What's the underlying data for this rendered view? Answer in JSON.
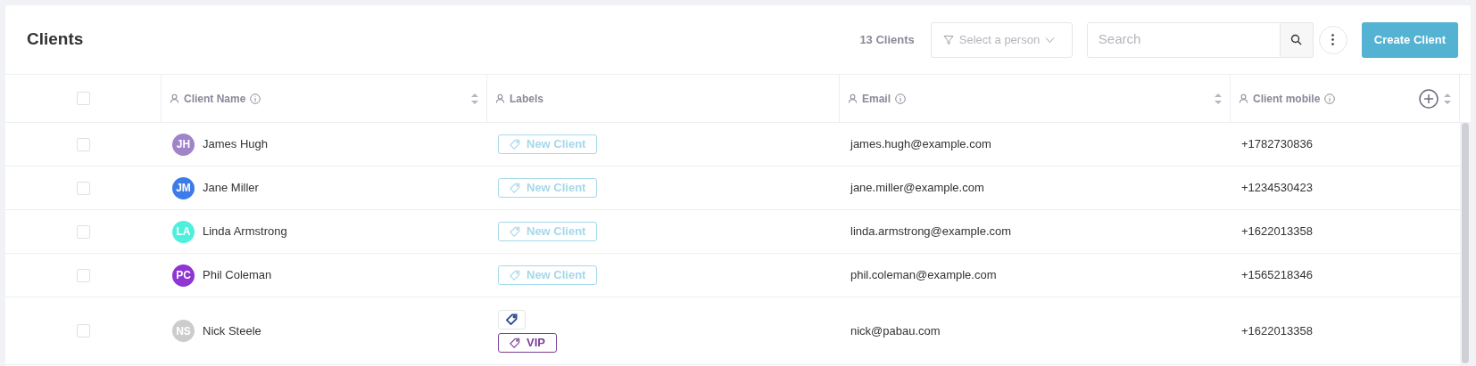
{
  "header": {
    "title": "Clients",
    "count": "13 Clients",
    "person_filter": {
      "placeholder": "Select a person"
    },
    "search": {
      "placeholder": "Search"
    },
    "create_button": "Create Client"
  },
  "table": {
    "select_all": {
      "checked": false
    },
    "columns": [
      {
        "label": "Client Name",
        "info": true,
        "sortable": true
      },
      {
        "label": "Labels",
        "info": false,
        "sortable": false
      },
      {
        "label": "Email",
        "info": true,
        "sortable": true
      },
      {
        "label": "Client mobile",
        "info": true,
        "sortable": true
      }
    ],
    "rows": [
      {
        "checked": false,
        "initials": "JH",
        "color": "#9f84c8",
        "name": "James Hugh",
        "labels": [
          {
            "kind": "tag",
            "text": "New Client",
            "color": "#a6d8ea"
          }
        ],
        "email": "james.hugh@example.com",
        "mobile": "+1782730836"
      },
      {
        "checked": false,
        "initials": "JM",
        "color": "#3d7be6",
        "name": "Jane Miller",
        "labels": [
          {
            "kind": "tag",
            "text": "New Client",
            "color": "#a6d8ea"
          }
        ],
        "email": "jane.miller@example.com",
        "mobile": "+1234530423"
      },
      {
        "checked": false,
        "initials": "LA",
        "color": "#4ff0db",
        "name": "Linda Armstrong",
        "labels": [
          {
            "kind": "tag",
            "text": "New Client",
            "color": "#a6d8ea"
          }
        ],
        "email": "linda.armstrong@example.com",
        "mobile": "+1622013358"
      },
      {
        "checked": false,
        "initials": "PC",
        "color": "#8e35d3",
        "name": "Phil Coleman",
        "labels": [
          {
            "kind": "tag",
            "text": "New Client",
            "color": "#a6d8ea"
          }
        ],
        "email": "phil.coleman@example.com",
        "mobile": "+1565218346"
      },
      {
        "checked": false,
        "initials": "NS",
        "color": "#cccccc",
        "name": "Nick Steele",
        "labels": [
          {
            "kind": "icon",
            "color": "#2c4a8f"
          },
          {
            "kind": "tag",
            "text": "VIP",
            "color": "#7b3f95"
          }
        ],
        "email": "nick@pabau.com",
        "mobile": "+1622013358"
      }
    ]
  }
}
